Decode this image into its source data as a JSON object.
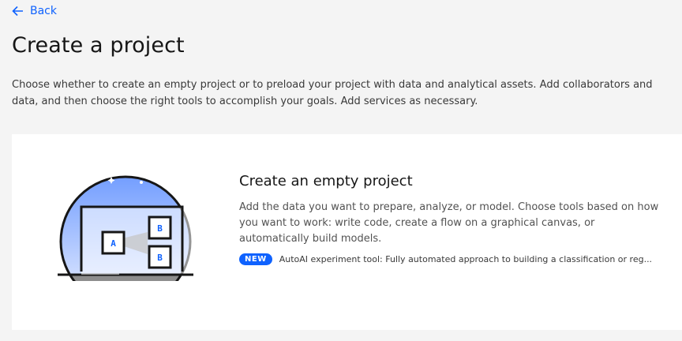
{
  "back": {
    "label": "Back"
  },
  "page": {
    "title": "Create a project",
    "description": "Choose whether to create an empty project or to preload your project with data and analytical assets. Add collaborators and data, and then choose the right tools to accomplish your goals. Add services as necessary."
  },
  "card": {
    "title": "Create an empty project",
    "description": "Add the data you want to prepare, analyze, or model. Choose tools based on how you want to work: write code, create a flow on a graphical canvas, or automatically build models.",
    "badge": "NEW",
    "note": "AutoAI experiment tool: Fully automated approach to building a classification or reg...",
    "illustration": {
      "box_a": "A",
      "box_b_top": "B",
      "box_b_bottom": "B"
    }
  },
  "colors": {
    "accent": "#0f62fe",
    "background": "#f4f4f4",
    "card": "#ffffff"
  },
  "icons": {
    "back": "arrow-left-icon"
  }
}
